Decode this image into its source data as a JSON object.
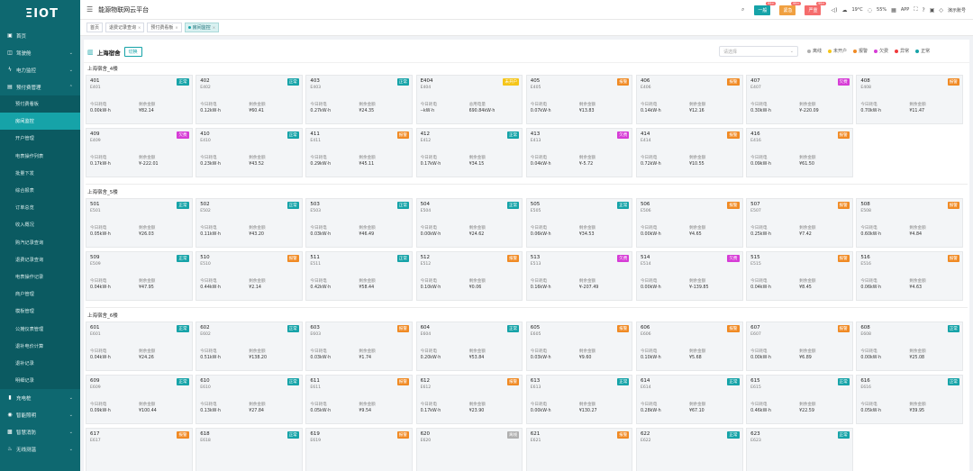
{
  "brand": "ΞIOT",
  "header": {
    "title": "能源物联网云平台",
    "badges": [
      {
        "label": "一般",
        "count": "99+",
        "color": "#16a3a8"
      },
      {
        "label": "紧急",
        "count": "99+",
        "color": "#f0a040"
      },
      {
        "label": "严重",
        "count": "99+",
        "color": "#f56c6c"
      }
    ],
    "weather": "19°C",
    "humidity": "55%",
    "app_label": "APP",
    "user": "演示账号"
  },
  "tabs": [
    {
      "label": "首页",
      "active": false
    },
    {
      "label": "退费记录查询",
      "active": false
    },
    {
      "label": "预付费看板",
      "active": false
    },
    {
      "label": "房间监控",
      "active": true
    }
  ],
  "sidebar": {
    "top": [
      {
        "label": "首页",
        "icon": "home-icon",
        "glyph": "▣"
      },
      {
        "label": "驾驶舱",
        "icon": "dashboard-icon",
        "glyph": "◫",
        "chev": "⌄"
      },
      {
        "label": "电力监控",
        "icon": "power-icon",
        "glyph": "ϟ",
        "chev": "⌄"
      },
      {
        "label": "预付费管理",
        "icon": "prepay-icon",
        "glyph": "▤",
        "chev": "⌃"
      }
    ],
    "sub": [
      {
        "label": "预付费看板",
        "active": false
      },
      {
        "label": "房间监控",
        "active": true
      },
      {
        "label": "开户管理",
        "active": false
      },
      {
        "label": "电表操作列表",
        "active": false
      },
      {
        "label": "批量下发",
        "active": false
      },
      {
        "label": "综合报表",
        "active": false
      },
      {
        "label": "订单总览",
        "active": false
      },
      {
        "label": "收入概况",
        "active": false
      },
      {
        "label": "购汽记录查询",
        "active": false
      },
      {
        "label": "退费记录查询",
        "active": false
      },
      {
        "label": "电表操作记录",
        "active": false
      },
      {
        "label": "商户管理",
        "active": false
      },
      {
        "label": "模板管理",
        "active": false
      },
      {
        "label": "公摊仪表管理",
        "active": false
      },
      {
        "label": "退补电价计算",
        "active": false
      },
      {
        "label": "退补记录",
        "active": false
      },
      {
        "label": "明细记录",
        "active": false
      }
    ],
    "bottom": [
      {
        "label": "充电桩",
        "icon": "charger-icon",
        "glyph": "▮",
        "chev": "⌄"
      },
      {
        "label": "智能照明",
        "icon": "light-icon",
        "glyph": "◉",
        "chev": "⌄"
      },
      {
        "label": "智慧消防",
        "icon": "fire-icon",
        "glyph": "▩",
        "chev": "⌄"
      },
      {
        "label": "无线测温",
        "icon": "temp-icon",
        "glyph": "♨",
        "chev": "⌄"
      }
    ]
  },
  "location": {
    "name": "上海宿舍",
    "switch_label": "切换"
  },
  "filter": {
    "placeholder": "请选择"
  },
  "legend": [
    {
      "label": "离线",
      "color": "#b0b0b0"
    },
    {
      "label": "未开户",
      "color": "#f5c518"
    },
    {
      "label": "报警",
      "color": "#f08a24"
    },
    {
      "label": "欠费",
      "color": "#d63cd6"
    },
    {
      "label": "异常",
      "color": "#f0393c"
    },
    {
      "label": "正常",
      "color": "#16a3a8"
    }
  ],
  "status_colors": {
    "正常": "#16a3a8",
    "未开户": "#f5c518",
    "报警": "#f08a24",
    "欠费": "#d63cd6",
    "离线": "#b0b0b0"
  },
  "floors": [
    {
      "title": "上海宿舍_4楼",
      "rooms": [
        {
          "room": "401",
          "meter": "E401",
          "status": "正常",
          "l1": "今日耗电",
          "v1": "0.00kW·h",
          "l2": "剩余金额",
          "v2": "¥82.14"
        },
        {
          "room": "402",
          "meter": "E402",
          "status": "正常",
          "l1": "今日耗电",
          "v1": "0.12kW·h",
          "l2": "剩余金额",
          "v2": "¥60.41"
        },
        {
          "room": "403",
          "meter": "E403",
          "status": "正常",
          "l1": "今日耗电",
          "v1": "0.27kW·h",
          "l2": "剩余金额",
          "v2": "¥24.35"
        },
        {
          "room": "E404",
          "meter": "E404",
          "status": "未开户",
          "l1": "今日耗电",
          "v1": "--kW·h",
          "l2": "总用电量",
          "v2": "690.84kW·h"
        },
        {
          "room": "405",
          "meter": "E405",
          "status": "报警",
          "l1": "今日耗电",
          "v1": "0.07kW·h",
          "l2": "剩余金额",
          "v2": "¥13.83"
        },
        {
          "room": "406",
          "meter": "E406",
          "status": "报警",
          "l1": "今日耗电",
          "v1": "0.14kW·h",
          "l2": "剩余金额",
          "v2": "¥12.16"
        },
        {
          "room": "407",
          "meter": "E407",
          "status": "欠费",
          "l1": "今日耗电",
          "v1": "0.30kW·h",
          "l2": "剩余金额",
          "v2": "¥-220.09"
        },
        {
          "room": "408",
          "meter": "E408",
          "status": "报警",
          "l1": "今日耗电",
          "v1": "0.70kW·h",
          "l2": "剩余金额",
          "v2": "¥11.47"
        },
        {
          "room": "409",
          "meter": "E409",
          "status": "欠费",
          "l1": "今日耗电",
          "v1": "0.17kW·h",
          "l2": "剩余金额",
          "v2": "¥-222.01"
        },
        {
          "room": "410",
          "meter": "E410",
          "status": "正常",
          "l1": "今日耗电",
          "v1": "0.23kW·h",
          "l2": "剩余金额",
          "v2": "¥43.52"
        },
        {
          "room": "411",
          "meter": "E411",
          "status": "报警",
          "l1": "今日耗电",
          "v1": "0.29kW·h",
          "l2": "剩余金额",
          "v2": "¥45.11"
        },
        {
          "room": "412",
          "meter": "E412",
          "status": "正常",
          "l1": "今日耗电",
          "v1": "0.17kW·h",
          "l2": "剩余金额",
          "v2": "¥34.15"
        },
        {
          "room": "413",
          "meter": "E413",
          "status": "欠费",
          "l1": "今日耗电",
          "v1": "0.04kW·h",
          "l2": "剩余金额",
          "v2": "¥-5.72"
        },
        {
          "room": "414",
          "meter": "E414",
          "status": "报警",
          "l1": "今日耗电",
          "v1": "0.72kW·h",
          "l2": "剩余金额",
          "v2": "¥10.55"
        },
        {
          "room": "416",
          "meter": "E416",
          "status": "报警",
          "l1": "今日耗电",
          "v1": "0.09kW·h",
          "l2": "剩余金额",
          "v2": "¥61.50"
        }
      ]
    },
    {
      "title": "上海宿舍_5楼",
      "rooms": [
        {
          "room": "501",
          "meter": "E501",
          "status": "正常",
          "l1": "今日耗电",
          "v1": "0.05kW·h",
          "l2": "剩余金额",
          "v2": "¥26.03"
        },
        {
          "room": "502",
          "meter": "E502",
          "status": "正常",
          "l1": "今日耗电",
          "v1": "0.11kW·h",
          "l2": "剩余金额",
          "v2": "¥43.20"
        },
        {
          "room": "503",
          "meter": "E503",
          "status": "正常",
          "l1": "今日耗电",
          "v1": "0.03kW·h",
          "l2": "剩余金额",
          "v2": "¥46.49"
        },
        {
          "room": "504",
          "meter": "E504",
          "status": "正常",
          "l1": "今日耗电",
          "v1": "0.00kW·h",
          "l2": "剩余金额",
          "v2": "¥24.62"
        },
        {
          "room": "505",
          "meter": "E505",
          "status": "正常",
          "l1": "今日耗电",
          "v1": "0.06kW·h",
          "l2": "剩余金额",
          "v2": "¥34.53"
        },
        {
          "room": "506",
          "meter": "E506",
          "status": "报警",
          "l1": "今日耗电",
          "v1": "0.00kW·h",
          "l2": "剩余金额",
          "v2": "¥4.65"
        },
        {
          "room": "507",
          "meter": "E507",
          "status": "报警",
          "l1": "今日耗电",
          "v1": "0.25kW·h",
          "l2": "剩余金额",
          "v2": "¥7.42"
        },
        {
          "room": "508",
          "meter": "E508",
          "status": "报警",
          "l1": "今日耗电",
          "v1": "0.60kW·h",
          "l2": "剩余金额",
          "v2": "¥4.84"
        },
        {
          "room": "509",
          "meter": "E509",
          "status": "正常",
          "l1": "今日耗电",
          "v1": "0.04kW·h",
          "l2": "剩余金额",
          "v2": "¥47.95"
        },
        {
          "room": "510",
          "meter": "E510",
          "status": "报警",
          "l1": "今日耗电",
          "v1": "0.44kW·h",
          "l2": "剩余金额",
          "v2": "¥2.14"
        },
        {
          "room": "511",
          "meter": "E511",
          "status": "正常",
          "l1": "今日耗电",
          "v1": "0.42kW·h",
          "l2": "剩余金额",
          "v2": "¥58.44"
        },
        {
          "room": "512",
          "meter": "E512",
          "status": "报警",
          "l1": "今日耗电",
          "v1": "0.10kW·h",
          "l2": "剩余金额",
          "v2": "¥0.06"
        },
        {
          "room": "513",
          "meter": "E513",
          "status": "欠费",
          "l1": "今日耗电",
          "v1": "0.16kW·h",
          "l2": "剩余金额",
          "v2": "¥-207.49"
        },
        {
          "room": "514",
          "meter": "E514",
          "status": "欠费",
          "l1": "今日耗电",
          "v1": "0.00kW·h",
          "l2": "剩余金额",
          "v2": "¥-139.85"
        },
        {
          "room": "515",
          "meter": "E515",
          "status": "报警",
          "l1": "今日耗电",
          "v1": "0.04kW·h",
          "l2": "剩余金额",
          "v2": "¥8.45"
        },
        {
          "room": "516",
          "meter": "E516",
          "status": "报警",
          "l1": "今日耗电",
          "v1": "0.06kW·h",
          "l2": "剩余金额",
          "v2": "¥4.63"
        }
      ]
    },
    {
      "title": "上海宿舍_6楼",
      "rooms": [
        {
          "room": "601",
          "meter": "E601",
          "status": "正常",
          "l1": "今日耗电",
          "v1": "0.04kW·h",
          "l2": "剩余金额",
          "v2": "¥24.26"
        },
        {
          "room": "602",
          "meter": "E602",
          "status": "正常",
          "l1": "今日耗电",
          "v1": "0.51kW·h",
          "l2": "剩余金额",
          "v2": "¥138.20"
        },
        {
          "room": "603",
          "meter": "E603",
          "status": "报警",
          "l1": "今日耗电",
          "v1": "0.03kW·h",
          "l2": "剩余金额",
          "v2": "¥1.74"
        },
        {
          "room": "604",
          "meter": "E604",
          "status": "正常",
          "l1": "今日耗电",
          "v1": "0.20kW·h",
          "l2": "剩余金额",
          "v2": "¥53.84"
        },
        {
          "room": "605",
          "meter": "E605",
          "status": "报警",
          "l1": "今日耗电",
          "v1": "0.03kW·h",
          "l2": "剩余金额",
          "v2": "¥9.60"
        },
        {
          "room": "606",
          "meter": "E606",
          "status": "报警",
          "l1": "今日耗电",
          "v1": "0.10kW·h",
          "l2": "剩余金额",
          "v2": "¥5.68"
        },
        {
          "room": "607",
          "meter": "E607",
          "status": "报警",
          "l1": "今日耗电",
          "v1": "0.00kW·h",
          "l2": "剩余金额",
          "v2": "¥6.89"
        },
        {
          "room": "608",
          "meter": "E608",
          "status": "正常",
          "l1": "今日耗电",
          "v1": "0.00kW·h",
          "l2": "剩余金额",
          "v2": "¥25.08"
        },
        {
          "room": "609",
          "meter": "E609",
          "status": "正常",
          "l1": "今日耗电",
          "v1": "0.09kW·h",
          "l2": "剩余金额",
          "v2": "¥100.44"
        },
        {
          "room": "610",
          "meter": "E610",
          "status": "正常",
          "l1": "今日耗电",
          "v1": "0.13kW·h",
          "l2": "剩余金额",
          "v2": "¥27.84"
        },
        {
          "room": "611",
          "meter": "E611",
          "status": "报警",
          "l1": "今日耗电",
          "v1": "0.05kW·h",
          "l2": "剩余金额",
          "v2": "¥9.54"
        },
        {
          "room": "612",
          "meter": "E612",
          "status": "报警",
          "l1": "今日耗电",
          "v1": "0.17kW·h",
          "l2": "剩余金额",
          "v2": "¥23.90"
        },
        {
          "room": "613",
          "meter": "E613",
          "status": "正常",
          "l1": "今日耗电",
          "v1": "0.00kW·h",
          "l2": "剩余金额",
          "v2": "¥130.27"
        },
        {
          "room": "614",
          "meter": "E614",
          "status": "正常",
          "l1": "今日耗电",
          "v1": "0.28kW·h",
          "l2": "剩余金额",
          "v2": "¥67.10"
        },
        {
          "room": "615",
          "meter": "E615",
          "status": "正常",
          "l1": "今日耗电",
          "v1": "0.46kW·h",
          "l2": "剩余金额",
          "v2": "¥22.59"
        },
        {
          "room": "616",
          "meter": "E616",
          "status": "正常",
          "l1": "今日耗电",
          "v1": "0.05kW·h",
          "l2": "剩余金额",
          "v2": "¥39.95"
        },
        {
          "room": "617",
          "meter": "E617",
          "status": "报警",
          "l1": "",
          "v1": "",
          "l2": "",
          "v2": ""
        },
        {
          "room": "618",
          "meter": "E618",
          "status": "正常",
          "l1": "",
          "v1": "",
          "l2": "",
          "v2": ""
        },
        {
          "room": "619",
          "meter": "E619",
          "status": "报警",
          "l1": "",
          "v1": "",
          "l2": "",
          "v2": ""
        },
        {
          "room": "620",
          "meter": "E620",
          "status": "离线",
          "l1": "",
          "v1": "",
          "l2": "",
          "v2": ""
        },
        {
          "room": "621",
          "meter": "E621",
          "status": "报警",
          "l1": "",
          "v1": "",
          "l2": "",
          "v2": ""
        },
        {
          "room": "622",
          "meter": "E622",
          "status": "正常",
          "l1": "",
          "v1": "",
          "l2": "",
          "v2": ""
        },
        {
          "room": "623",
          "meter": "E623",
          "status": "正常",
          "l1": "",
          "v1": "",
          "l2": "",
          "v2": ""
        }
      ]
    }
  ]
}
